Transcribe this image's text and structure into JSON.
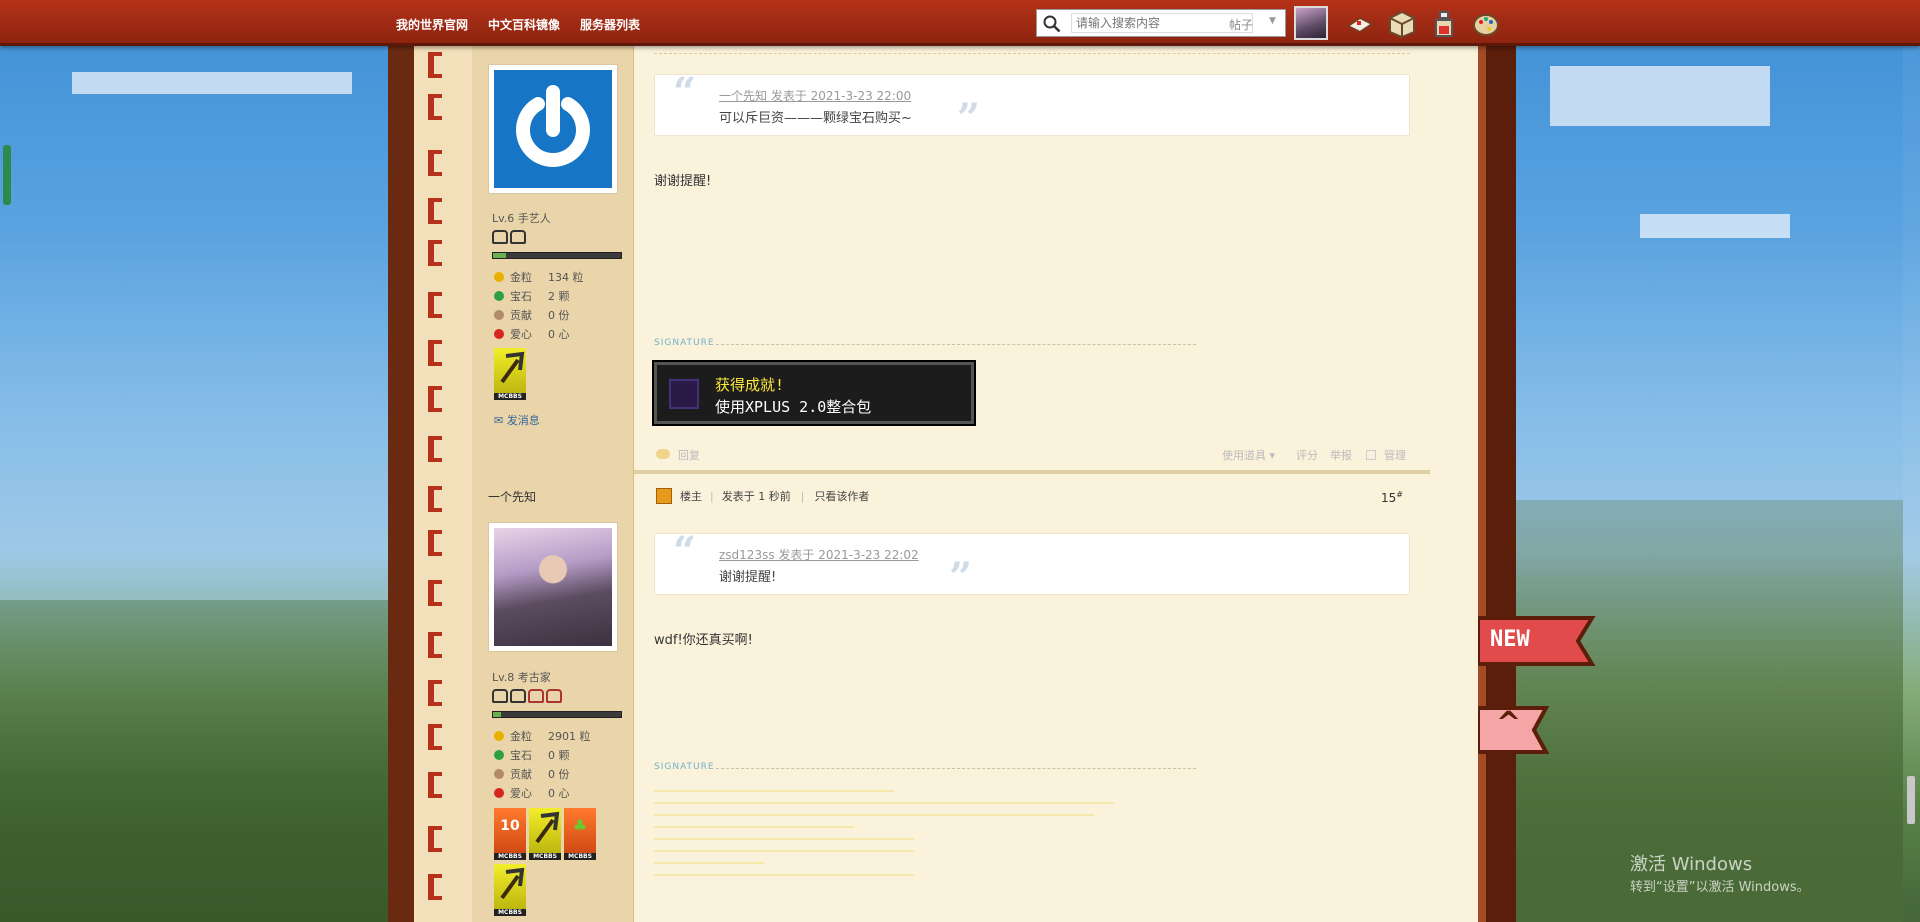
{
  "topbar": {
    "links": [
      "我的世界官网",
      "中文百科镜像",
      "服务器列表"
    ],
    "search_placeholder": "请输入搜索内容",
    "search_type": "帖子"
  },
  "post1": {
    "user_level": "Lv.6 手艺人",
    "level_progress": 0.1,
    "stats": [
      {
        "key": "金粒",
        "value": "134 粒",
        "color": "#e8b100"
      },
      {
        "key": "宝石",
        "value": "2 颗",
        "color": "#2ea043"
      },
      {
        "key": "贡献",
        "value": "0 份",
        "color": "#b08a6a"
      },
      {
        "key": "爱心",
        "value": "0 心",
        "color": "#d7261e"
      }
    ],
    "medal_label": "MCBBS",
    "send_message": "发消息",
    "quote_author": "一个先知 发表于 2021-3-23 22:00",
    "quote_text": "可以斥巨资———颗绿宝石购买~",
    "body": "谢谢提醒!",
    "signature_label": "SIGNATURE",
    "achievement_title": "获得成就!",
    "achievement_desc": "使用XPLUS 2.0整合包",
    "reply": "回复",
    "actions": [
      "使用道具",
      "评分",
      "举报",
      "管理"
    ]
  },
  "post2": {
    "username": "一个先知",
    "user_level": "Lv.8 考古家",
    "level_progress": 0.06,
    "stats": [
      {
        "key": "金粒",
        "value": "2901 粒",
        "color": "#e8b100"
      },
      {
        "key": "宝石",
        "value": "0 颗",
        "color": "#2ea043"
      },
      {
        "key": "贡献",
        "value": "0 份",
        "color": "#b08a6a"
      },
      {
        "key": "爱心",
        "value": "0 心",
        "color": "#d7261e"
      }
    ],
    "medals": [
      "MCBBS",
      "MCBBS",
      "MCBBS",
      "MCBBS"
    ],
    "floor_owner": "楼主",
    "posted": "发表于 1 秒前",
    "only_author": "只看该作者",
    "floor_number": "15",
    "quote_author": "zsd123ss 发表于 2021-3-23 22:02",
    "quote_text": "谢谢提醒!",
    "body": "wdf!你还真买啊!",
    "signature_label": "SIGNATURE"
  },
  "floating": {
    "new_label": "NEW",
    "top_label": "^"
  },
  "watermark": {
    "title": "激活 Windows",
    "subtitle": "转到“设置”以激活 Windows。"
  }
}
